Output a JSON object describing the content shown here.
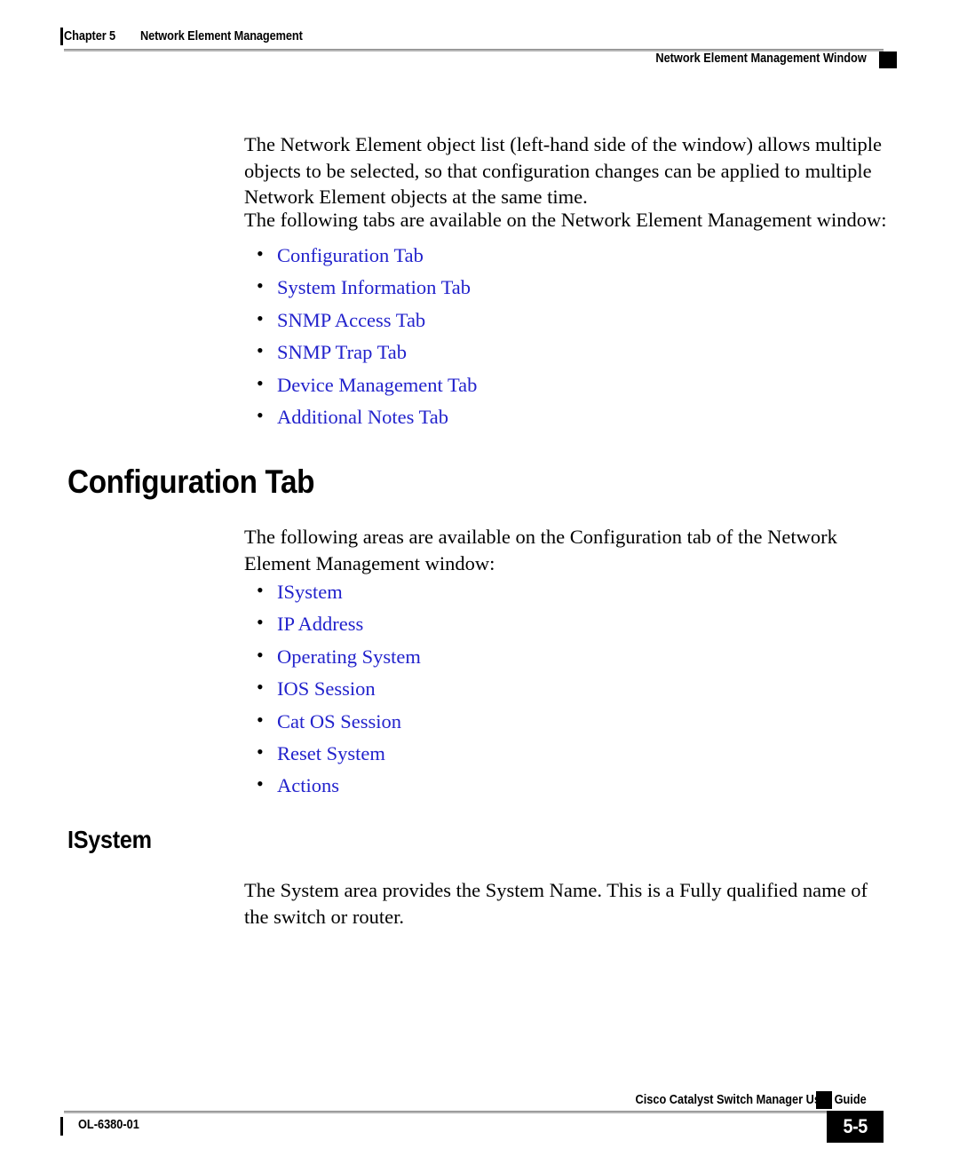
{
  "header": {
    "chapter_number": "Chapter 5",
    "chapter_title": "Network Element Management",
    "running_head_right": "Network Element Management Window"
  },
  "body": {
    "paragraph_1": "The Network Element object list (left-hand side of the window) allows multiple objects to be selected, so that configuration changes can be applied to multiple Network Element objects at the same time.",
    "paragraph_2": "The following tabs are available on the Network Element Management window:",
    "tab_links": [
      {
        "label": "Configuration Tab"
      },
      {
        "label": "System Information Tab"
      },
      {
        "label": "SNMP Access Tab"
      },
      {
        "label": "SNMP Trap Tab"
      },
      {
        "label": "Device Management Tab"
      },
      {
        "label": "Additional Notes Tab"
      }
    ],
    "heading_1": "Configuration Tab",
    "paragraph_3": "The following areas are available on the Configuration tab of the Network Element Management window:",
    "area_links": [
      {
        "label": "ISystem"
      },
      {
        "label": "IP Address"
      },
      {
        "label": "Operating System"
      },
      {
        "label": "IOS Session"
      },
      {
        "label": "Cat OS Session"
      },
      {
        "label": "Reset System"
      },
      {
        "label": "Actions"
      }
    ],
    "heading_2": "ISystem",
    "paragraph_4": "The System area provides the System Name. This is a Fully qualified name of the switch or router."
  },
  "footer": {
    "guide_title": "Cisco Catalyst Switch Manager User Guide",
    "document_number": "OL-6380-01",
    "page_number": "5-5"
  },
  "colors": {
    "link": "#2222cc",
    "text": "#000000",
    "rule": "#b4b4b4",
    "page_box": "#000000"
  }
}
